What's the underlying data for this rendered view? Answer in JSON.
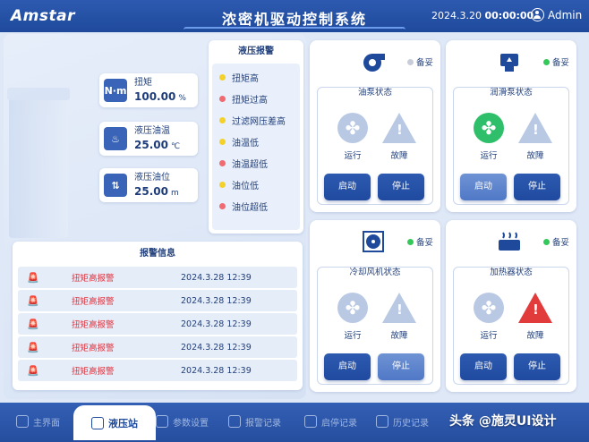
{
  "header": {
    "logo": "Amstar",
    "title": "浓密机驱动控制系统",
    "date": "2024.3.20",
    "time": "00:00:00",
    "user": "Admin"
  },
  "metrics": [
    {
      "label": "扭矩",
      "value": "100.00",
      "unit": "%",
      "icon": "torque-icon"
    },
    {
      "label": "液压油温",
      "value": "25.00",
      "unit": "℃",
      "icon": "oil-temp-icon"
    },
    {
      "label": "液压油位",
      "value": "25.00",
      "unit": "m",
      "icon": "oil-level-icon"
    }
  ],
  "alarm_list": {
    "title": "液压报警",
    "items": [
      {
        "label": "扭矩高",
        "color": "#f2d22a"
      },
      {
        "label": "扭矩过高",
        "color": "#f06a72"
      },
      {
        "label": "过滤网压差高",
        "color": "#f2d22a"
      },
      {
        "label": "油温低",
        "color": "#f2d22a"
      },
      {
        "label": "油温超低",
        "color": "#f06a72"
      },
      {
        "label": "油位低",
        "color": "#f2d22a"
      },
      {
        "label": "油位超低",
        "color": "#f06a72"
      }
    ]
  },
  "alarm_info": {
    "title": "报警信息",
    "rows": [
      {
        "text": "扭矩高报警",
        "time": "2024.3.28 12:39"
      },
      {
        "text": "扭矩高报警",
        "time": "2024.3.28 12:39"
      },
      {
        "text": "扭矩高报警",
        "time": "2024.3.28 12:39"
      },
      {
        "text": "扭矩高报警",
        "time": "2024.3.28 12:39"
      },
      {
        "text": "扭矩高报警",
        "time": "2024.3.28 12:39"
      }
    ]
  },
  "devices": [
    {
      "status_title": "油泵状态",
      "standby": "备妥",
      "standby_color": "#c7ced9",
      "run_label": "运行",
      "fault_label": "故障",
      "run_color": "#b9c9e4",
      "fault_color": "#b9c9e4",
      "start": "启动",
      "stop": "停止",
      "icon": "oil-pump-icon"
    },
    {
      "status_title": "润滑泵状态",
      "standby": "备妥",
      "standby_color": "#34c759",
      "run_label": "运行",
      "fault_label": "故障",
      "run_color": "#2fbf6a",
      "fault_color": "#b9c9e4",
      "start": "启动",
      "stop": "停止",
      "icon": "lube-pump-icon"
    },
    {
      "status_title": "冷却风机状态",
      "standby": "备妥",
      "standby_color": "#34c759",
      "run_label": "运行",
      "fault_label": "故障",
      "run_color": "#b9c9e4",
      "fault_color": "#b9c9e4",
      "start": "启动",
      "stop": "停止",
      "icon": "cooling-fan-icon"
    },
    {
      "status_title": "加热器状态",
      "standby": "备妥",
      "standby_color": "#34c759",
      "run_label": "运行",
      "fault_label": "故障",
      "run_color": "#b9c9e4",
      "fault_color": "#e23b3b",
      "start": "启动",
      "stop": "停止",
      "icon": "heater-icon"
    }
  ],
  "nav": [
    {
      "label": "主界面",
      "icon": "home-icon"
    },
    {
      "label": "液压站",
      "icon": "hydraulic-station-icon"
    },
    {
      "label": "参数设置",
      "icon": "settings-icon"
    },
    {
      "label": "报警记录",
      "icon": "alarm-record-icon"
    },
    {
      "label": "启停记录",
      "icon": "power-record-icon"
    },
    {
      "label": "历史记录",
      "icon": "history-icon"
    }
  ],
  "watermark": "头条 @施灵UI设计"
}
